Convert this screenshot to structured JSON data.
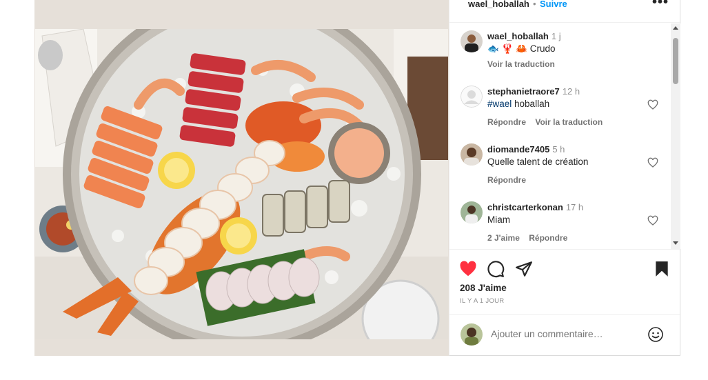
{
  "header": {
    "username": "wael_hoballah",
    "separator": "•",
    "follow_label": "Suivre",
    "more_label": "•••"
  },
  "caption": {
    "username": "wael_hoballah",
    "time": "1 j",
    "emojis": "🐟 🦞 🦀",
    "text": "Crudo",
    "translate_label": "Voir la traduction"
  },
  "comments": [
    {
      "username": "stephanietraore7",
      "time": "12 h",
      "hashtag": "#wael",
      "text": " hoballah",
      "reply_label": "Répondre",
      "translate_label": "Voir la traduction"
    },
    {
      "username": "diomande7405",
      "time": "5 h",
      "text": "Quelle talent de création",
      "reply_label": "Répondre"
    },
    {
      "username": "christcarterkonan",
      "time": "17 h",
      "text": "Miam",
      "likes_label": "2 J'aime",
      "reply_label": "Répondre"
    }
  ],
  "post": {
    "likes": "208 J'aime",
    "posted": "IL Y A 1 JOUR"
  },
  "add_comment": {
    "placeholder": "Ajouter un commentaire…"
  },
  "colors": {
    "accent": "#0095f6",
    "like_red": "#ff3040",
    "muted": "#8e8e8e",
    "text": "#262626"
  },
  "icons": {
    "like": "heart-filled-icon",
    "comment": "comment-bubble-icon",
    "share": "paper-plane-icon",
    "save": "bookmark-filled-icon",
    "emoji": "smiley-icon",
    "more": "three-dots-icon"
  }
}
